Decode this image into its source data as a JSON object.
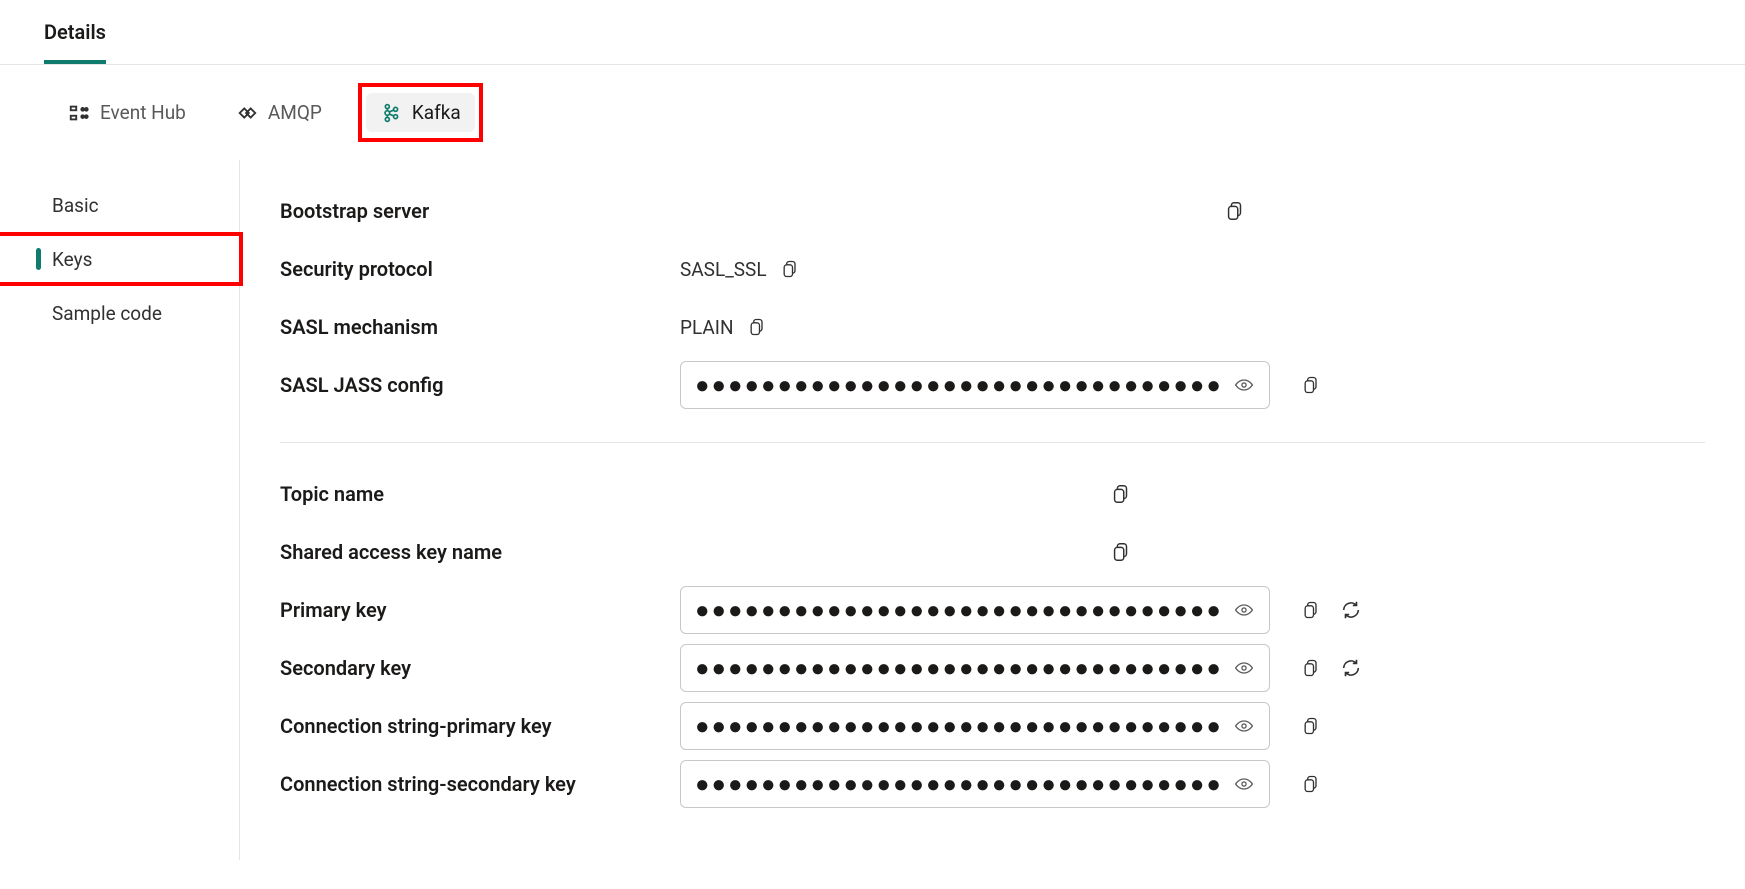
{
  "top_tab": {
    "label": "Details"
  },
  "hubs": [
    {
      "id": "eventhub",
      "label": "Event Hub"
    },
    {
      "id": "amqp",
      "label": "AMQP"
    },
    {
      "id": "kafka",
      "label": "Kafka"
    }
  ],
  "sidebar": {
    "items": [
      {
        "id": "basic",
        "label": "Basic"
      },
      {
        "id": "keys",
        "label": "Keys"
      },
      {
        "id": "sample",
        "label": "Sample code"
      }
    ]
  },
  "main": {
    "bootstrap_server_label": "Bootstrap server",
    "security_protocol_label": "Security protocol",
    "security_protocol_value": "SASL_SSL",
    "sasl_mechanism_label": "SASL mechanism",
    "sasl_mechanism_value": "PLAIN",
    "sasl_jaas_label": "SASL JASS config",
    "topic_name_label": "Topic name",
    "shared_access_key_name_label": "Shared access key name",
    "primary_key_label": "Primary key",
    "secondary_key_label": "Secondary key",
    "conn_primary_label": "Connection string-primary key",
    "conn_secondary_label": "Connection string-secondary key",
    "masked_dots": "●●●●●●●●●●●●●●●●●●●●●●●●●●●●●●●●●●●●●●●●●●●●●●●●●●●●●●●●●●●●●●●●●●●●"
  }
}
